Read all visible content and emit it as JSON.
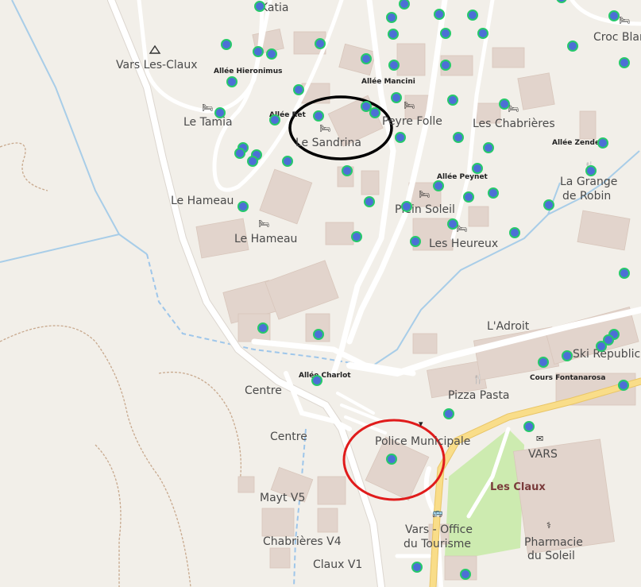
{
  "map_title": "",
  "labels": {
    "katia": "Katia",
    "vars_les_claux_top": "Vars Les-Claux",
    "allee_hieronimus": "Allée Hieronimus",
    "le_tamia": "Le Tamia",
    "allee_ret": "Allée Ret",
    "le_sandrina": "Le Sandrina",
    "allee_mancini": "Allée Mancini",
    "peyre_folle": "Peyre Folle",
    "les_chabrieres": "Les Chabrières",
    "croc_blanc": "Croc Blan",
    "allee_zendel": "Allée Zendel",
    "la_grange": "La Grange",
    "de_robin": "de Robin",
    "allee_peynet": "Allée Peynet",
    "le_hameau_1": "Le Hameau",
    "le_hameau_2": "Le Hameau",
    "plein_soleil": "Plein Soleil",
    "les_heureux": "Les Heureux",
    "l_adroit": "L'Adroit",
    "ski_republic": "Ski Republic",
    "cours_fontanarosa": "Cours Fontanarosa",
    "allee_charlot": "Allée Charlot",
    "centre_1": "Centre",
    "centre_2": "Centre",
    "pizza_pasta": "Pizza Pasta",
    "police_municipale": "Police Municipale",
    "vars": "VARS",
    "les_claux": "Les Claux",
    "mayt_v5": "Mayt V5",
    "vars_office": "Vars - Office",
    "du_tourisme": "du Tourisme",
    "chabrieres_v4": "Chabrières V4",
    "pharmacie": "Pharmacie",
    "du_soleil": "du Soleil",
    "claux_v1": "Claux V1"
  },
  "annotations": {
    "black_circle_color": "#000000",
    "red_circle_color": "#e01b1b"
  },
  "marker_style": {
    "fill": "#4c6fd6",
    "ring": "#27c96b"
  }
}
